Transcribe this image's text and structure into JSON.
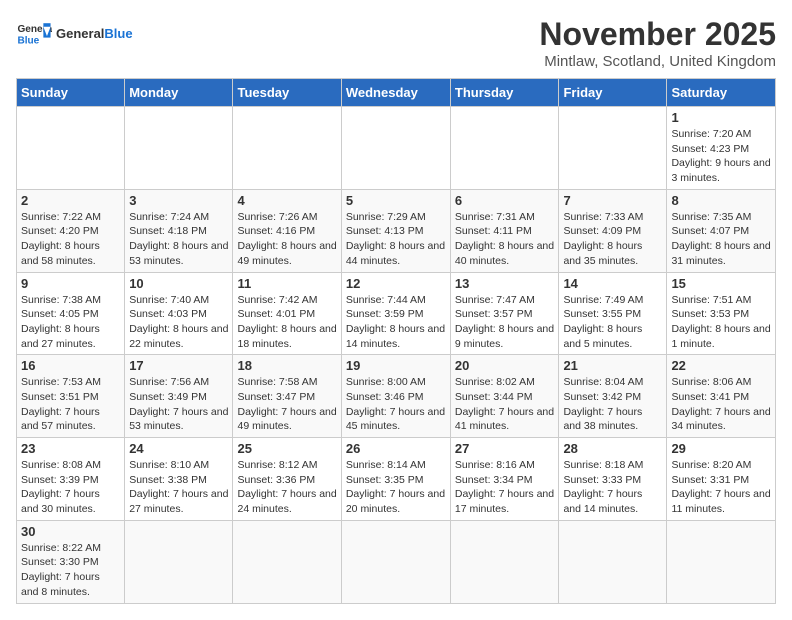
{
  "header": {
    "logo_general": "General",
    "logo_blue": "Blue",
    "month": "November 2025",
    "location": "Mintlaw, Scotland, United Kingdom"
  },
  "weekdays": [
    "Sunday",
    "Monday",
    "Tuesday",
    "Wednesday",
    "Thursday",
    "Friday",
    "Saturday"
  ],
  "weeks": [
    [
      {
        "day": "",
        "info": ""
      },
      {
        "day": "",
        "info": ""
      },
      {
        "day": "",
        "info": ""
      },
      {
        "day": "",
        "info": ""
      },
      {
        "day": "",
        "info": ""
      },
      {
        "day": "",
        "info": ""
      },
      {
        "day": "1",
        "info": "Sunrise: 7:20 AM\nSunset: 4:23 PM\nDaylight: 9 hours and 3 minutes."
      }
    ],
    [
      {
        "day": "2",
        "info": "Sunrise: 7:22 AM\nSunset: 4:20 PM\nDaylight: 8 hours and 58 minutes."
      },
      {
        "day": "3",
        "info": "Sunrise: 7:24 AM\nSunset: 4:18 PM\nDaylight: 8 hours and 53 minutes."
      },
      {
        "day": "4",
        "info": "Sunrise: 7:26 AM\nSunset: 4:16 PM\nDaylight: 8 hours and 49 minutes."
      },
      {
        "day": "5",
        "info": "Sunrise: 7:29 AM\nSunset: 4:13 PM\nDaylight: 8 hours and 44 minutes."
      },
      {
        "day": "6",
        "info": "Sunrise: 7:31 AM\nSunset: 4:11 PM\nDaylight: 8 hours and 40 minutes."
      },
      {
        "day": "7",
        "info": "Sunrise: 7:33 AM\nSunset: 4:09 PM\nDaylight: 8 hours and 35 minutes."
      },
      {
        "day": "8",
        "info": "Sunrise: 7:35 AM\nSunset: 4:07 PM\nDaylight: 8 hours and 31 minutes."
      }
    ],
    [
      {
        "day": "9",
        "info": "Sunrise: 7:38 AM\nSunset: 4:05 PM\nDaylight: 8 hours and 27 minutes."
      },
      {
        "day": "10",
        "info": "Sunrise: 7:40 AM\nSunset: 4:03 PM\nDaylight: 8 hours and 22 minutes."
      },
      {
        "day": "11",
        "info": "Sunrise: 7:42 AM\nSunset: 4:01 PM\nDaylight: 8 hours and 18 minutes."
      },
      {
        "day": "12",
        "info": "Sunrise: 7:44 AM\nSunset: 3:59 PM\nDaylight: 8 hours and 14 minutes."
      },
      {
        "day": "13",
        "info": "Sunrise: 7:47 AM\nSunset: 3:57 PM\nDaylight: 8 hours and 9 minutes."
      },
      {
        "day": "14",
        "info": "Sunrise: 7:49 AM\nSunset: 3:55 PM\nDaylight: 8 hours and 5 minutes."
      },
      {
        "day": "15",
        "info": "Sunrise: 7:51 AM\nSunset: 3:53 PM\nDaylight: 8 hours and 1 minute."
      }
    ],
    [
      {
        "day": "16",
        "info": "Sunrise: 7:53 AM\nSunset: 3:51 PM\nDaylight: 7 hours and 57 minutes."
      },
      {
        "day": "17",
        "info": "Sunrise: 7:56 AM\nSunset: 3:49 PM\nDaylight: 7 hours and 53 minutes."
      },
      {
        "day": "18",
        "info": "Sunrise: 7:58 AM\nSunset: 3:47 PM\nDaylight: 7 hours and 49 minutes."
      },
      {
        "day": "19",
        "info": "Sunrise: 8:00 AM\nSunset: 3:46 PM\nDaylight: 7 hours and 45 minutes."
      },
      {
        "day": "20",
        "info": "Sunrise: 8:02 AM\nSunset: 3:44 PM\nDaylight: 7 hours and 41 minutes."
      },
      {
        "day": "21",
        "info": "Sunrise: 8:04 AM\nSunset: 3:42 PM\nDaylight: 7 hours and 38 minutes."
      },
      {
        "day": "22",
        "info": "Sunrise: 8:06 AM\nSunset: 3:41 PM\nDaylight: 7 hours and 34 minutes."
      }
    ],
    [
      {
        "day": "23",
        "info": "Sunrise: 8:08 AM\nSunset: 3:39 PM\nDaylight: 7 hours and 30 minutes."
      },
      {
        "day": "24",
        "info": "Sunrise: 8:10 AM\nSunset: 3:38 PM\nDaylight: 7 hours and 27 minutes."
      },
      {
        "day": "25",
        "info": "Sunrise: 8:12 AM\nSunset: 3:36 PM\nDaylight: 7 hours and 24 minutes."
      },
      {
        "day": "26",
        "info": "Sunrise: 8:14 AM\nSunset: 3:35 PM\nDaylight: 7 hours and 20 minutes."
      },
      {
        "day": "27",
        "info": "Sunrise: 8:16 AM\nSunset: 3:34 PM\nDaylight: 7 hours and 17 minutes."
      },
      {
        "day": "28",
        "info": "Sunrise: 8:18 AM\nSunset: 3:33 PM\nDaylight: 7 hours and 14 minutes."
      },
      {
        "day": "29",
        "info": "Sunrise: 8:20 AM\nSunset: 3:31 PM\nDaylight: 7 hours and 11 minutes."
      }
    ],
    [
      {
        "day": "30",
        "info": "Sunrise: 8:22 AM\nSunset: 3:30 PM\nDaylight: 7 hours and 8 minutes."
      },
      {
        "day": "",
        "info": ""
      },
      {
        "day": "",
        "info": ""
      },
      {
        "day": "",
        "info": ""
      },
      {
        "day": "",
        "info": ""
      },
      {
        "day": "",
        "info": ""
      },
      {
        "day": "",
        "info": ""
      }
    ]
  ]
}
